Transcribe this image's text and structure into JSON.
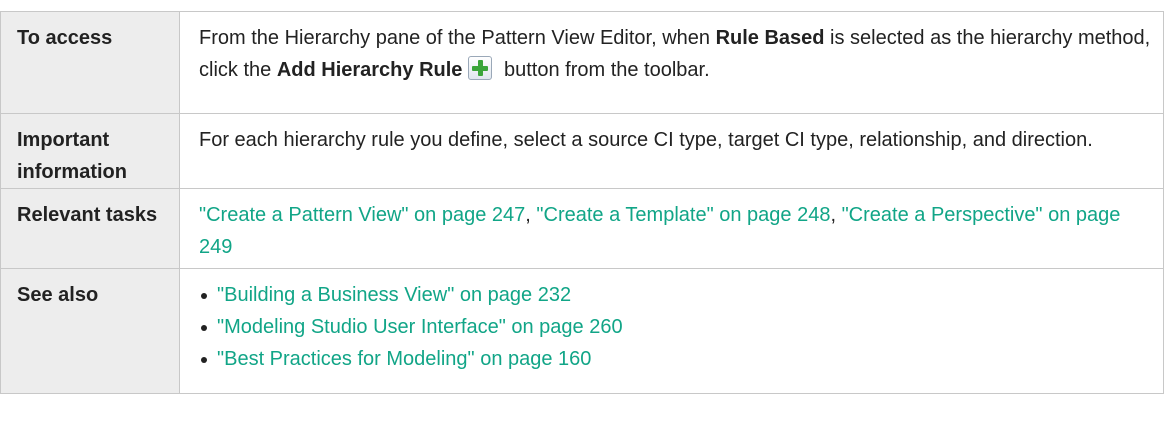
{
  "rows": {
    "access": {
      "label": "To access",
      "text_1": "From the Hierarchy pane of the Pattern View Editor, when ",
      "bold_1": "Rule Based",
      "text_2": " is selected as the hierarchy method, click the ",
      "bold_2": "Add Hierarchy Rule",
      "text_3": " button from the toolbar.",
      "icon": "add-plus-icon"
    },
    "important": {
      "label": "Important information",
      "text": "For each hierarchy rule you define, select a source CI type, target CI type, relationship, and direction."
    },
    "tasks": {
      "label": "Relevant tasks",
      "links": [
        "\"Create a Pattern View\" on page 247",
        "\"Create a Template\" on page 248",
        "\"Create a Perspective\" on page 249"
      ],
      "separator": ", "
    },
    "see_also": {
      "label": "See also",
      "links": [
        "\"Building a Business View\" on page 232",
        "\"Modeling Studio User Interface\" on page 260",
        "\"Best Practices for Modeling\" on page 160"
      ]
    }
  },
  "colors": {
    "link": "#11a587",
    "label_bg": "#ededed",
    "border": "#c8c8c8"
  }
}
